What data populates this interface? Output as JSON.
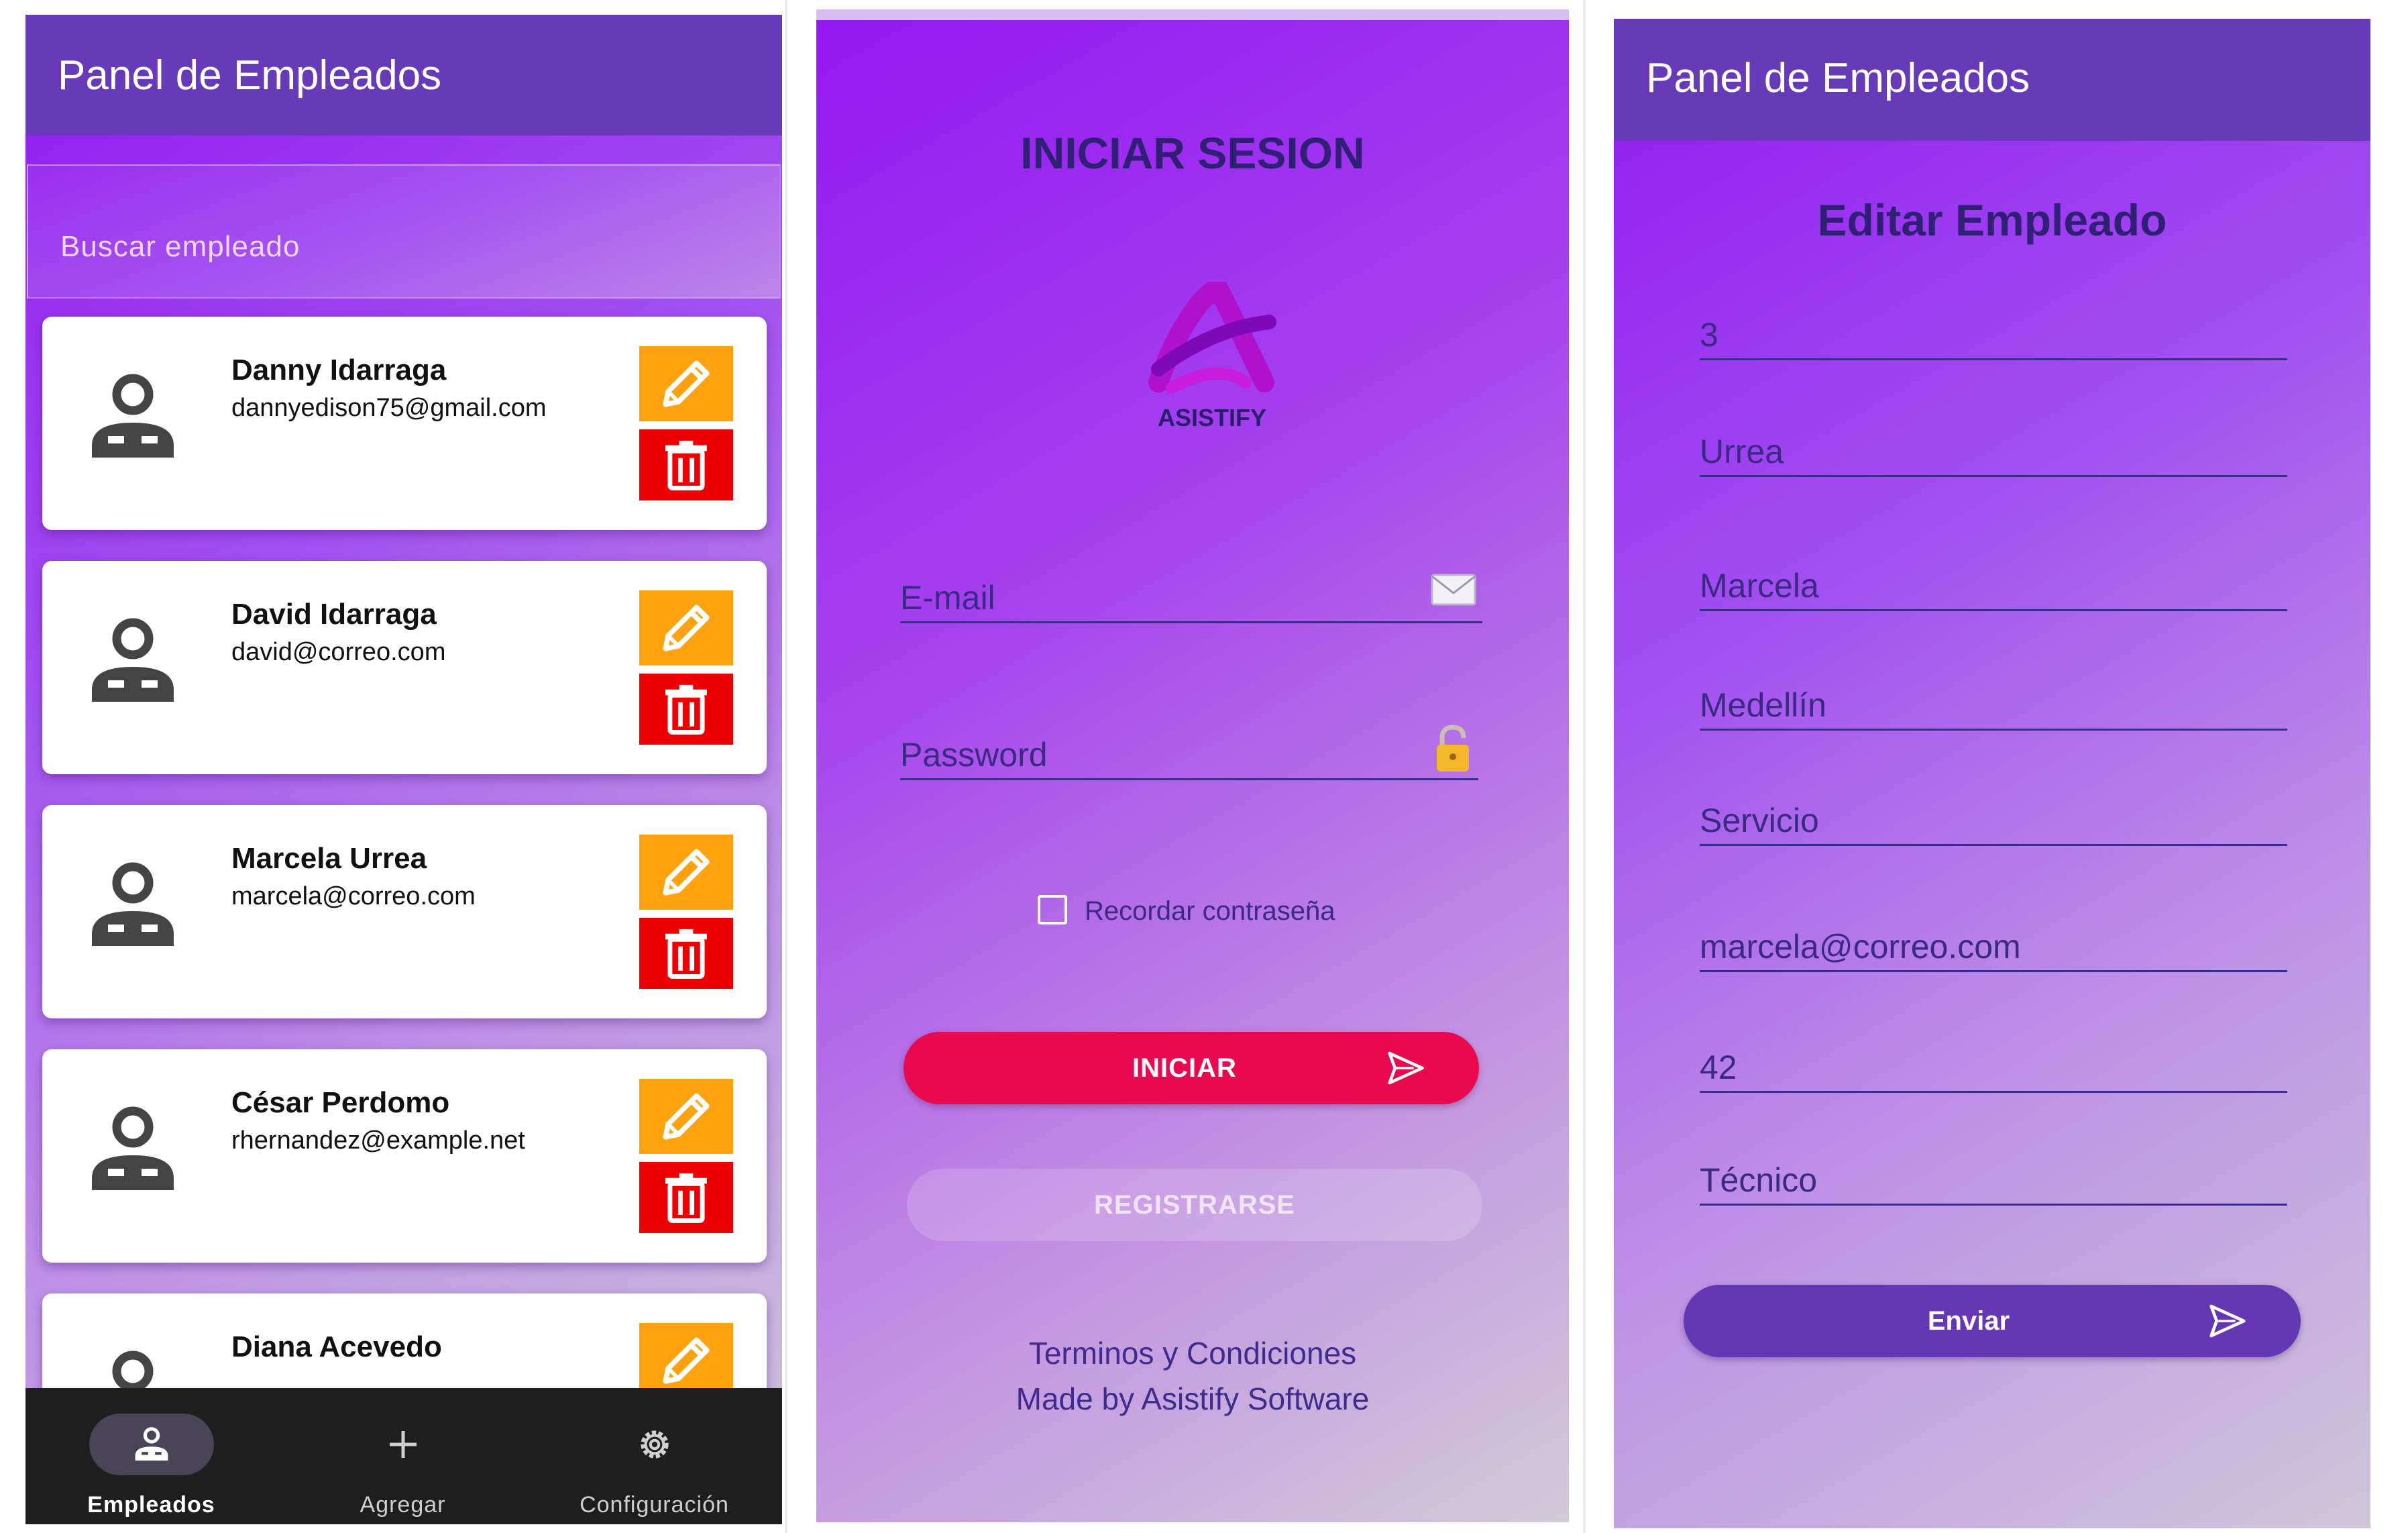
{
  "colors": {
    "app_bar": "#673ab7",
    "edit_button": "#ffa20d",
    "delete_button": "#ee0000",
    "login_button": "#e8094f",
    "submit_button": "#6637b5",
    "bottom_nav": "#1e1e1e",
    "text_dark_blue": "#3a2a83"
  },
  "left": {
    "app_title": "Panel de Empleados",
    "search": {
      "placeholder": "Buscar empleado"
    },
    "employees": [
      {
        "name": "Danny Idarraga",
        "email": "dannyedison75@gmail.com"
      },
      {
        "name": "David Idarraga",
        "email": "david@correo.com"
      },
      {
        "name": "Marcela Urrea",
        "email": "marcela@correo.com"
      },
      {
        "name": "César Perdomo",
        "email": "rhernandez@example.net"
      },
      {
        "name": "Diana Acevedo",
        "email": ""
      }
    ],
    "icons": {
      "avatar": "person-badge-icon",
      "edit": "pencil-icon",
      "delete": "trash-icon"
    },
    "nav": [
      {
        "label": "Empleados",
        "icon": "person-badge-icon",
        "selected": true
      },
      {
        "label": "Agregar",
        "icon": "plus-icon",
        "selected": false
      },
      {
        "label": "Configuración",
        "icon": "gear-icon",
        "selected": false
      }
    ]
  },
  "login": {
    "title": "INICIAR SESION",
    "logo_text": "ASISTIFY",
    "email_placeholder": "E-mail",
    "password_placeholder": "Password",
    "remember_label": "Recordar contraseña",
    "login_button": "INICIAR",
    "register_button": "REGISTRARSE",
    "footer": [
      "Terminos y Condiciones",
      "Made by Asistify Software"
    ],
    "icons": {
      "email": "envelope-icon",
      "password": "lock-icon",
      "login": "send-icon"
    }
  },
  "edit": {
    "app_title": "Panel de Empleados",
    "heading": "Editar Empleado",
    "fields": [
      "3",
      "Urrea",
      "Marcela",
      "Medellín",
      "Servicio",
      "marcela@correo.com",
      "42",
      "Técnico"
    ],
    "submit_button": "Enviar",
    "icons": {
      "submit": "send-icon"
    }
  }
}
